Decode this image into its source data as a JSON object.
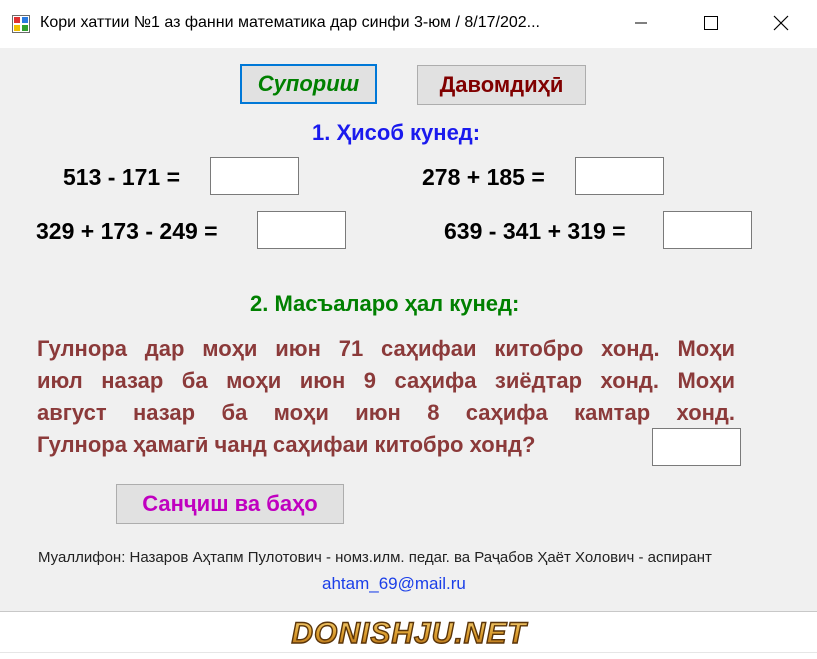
{
  "window": {
    "title": "Кори хаттии №1 аз фанни математика дар синфи 3-юм  / 8/17/202..."
  },
  "buttons": {
    "assign": "Супориш",
    "next": "Давомдиҳӣ",
    "check": "Санҷиш ва баҳо"
  },
  "section1": {
    "heading": "1. Ҳисоб кунед:",
    "expressions": [
      "513 - 171 =",
      "278 + 185 =",
      "329 + 173 - 249 =",
      "639 - 341 + 319 ="
    ],
    "answers": [
      "",
      "",
      "",
      ""
    ]
  },
  "section2": {
    "heading": "2. Масъаларо ҳал кунед:",
    "lines": [
      "Гулнора дар моҳи июн 71 саҳифаи китобро хонд. Моҳи",
      "июл назар ба моҳи июн 9 саҳифа  зиёдтар  хонд. Моҳи",
      "август  назар  ба  моҳи  июн  8  саҳифа  камтар  хонд.",
      "Гулнора ҳамагӣ чанд саҳифаи китобро хонд?"
    ],
    "answer": ""
  },
  "footer": {
    "authors": "Муаллифон: Назаров Аҳтапм Пулотович - номз.илм. педаг. ва Раҷабов Ҳаёт Холович - аспирант",
    "email": "ahtam_69@mail.ru"
  },
  "watermark": {
    "text": "DONISHJU.NET"
  },
  "colors": {
    "assign_text": "#008000",
    "next_text": "#800000",
    "check_text": "#c000c0",
    "heading1": "#1a1aee",
    "heading2": "#008000",
    "problem_text": "#8b3a3a",
    "email": "#1a3ee8"
  }
}
